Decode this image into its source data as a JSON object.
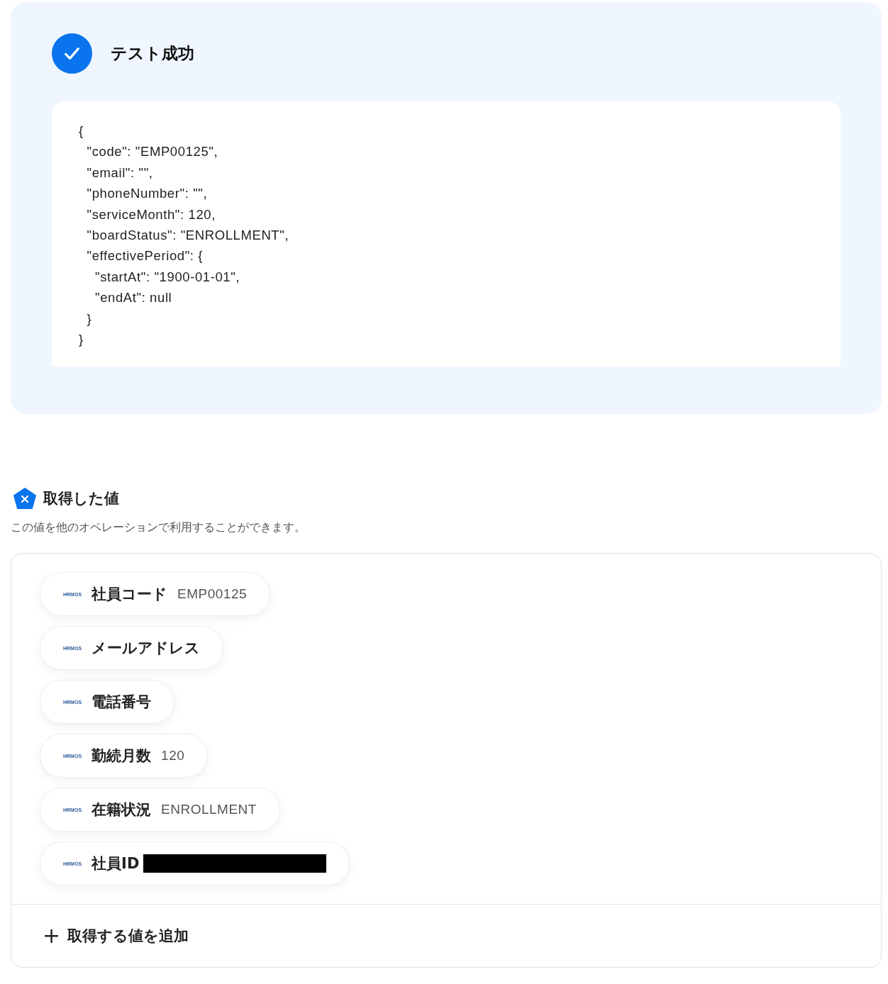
{
  "test_result": {
    "title": "テスト成功",
    "success": true,
    "code_lines": [
      "{",
      "  \"code\": \"EMP00125\",",
      "  \"email\": \"\",",
      "  \"phoneNumber\": \"\",",
      "  \"serviceMonth\": 120,",
      "  \"boardStatus\": \"ENROLLMENT\",",
      "  \"effectivePeriod\": {",
      "    \"startAt\": \"1900-01-01\",",
      "    \"endAt\": null",
      "  }",
      "}"
    ]
  },
  "values_section": {
    "title": "取得した値",
    "description": "この値を他のオペレーションで利用することができます。",
    "items": [
      {
        "logo": "HRMOS",
        "label": "社員コード",
        "value": "EMP00125",
        "redacted": false
      },
      {
        "logo": "HRMOS",
        "label": "メールアドレス",
        "redacted": false
      },
      {
        "logo": "HRMOS",
        "label": "電話番号",
        "redacted": false
      },
      {
        "logo": "HRMOS",
        "label": "勤続月数",
        "value": "120",
        "redacted": false
      },
      {
        "logo": "HRMOS",
        "label": "在籍状況",
        "value": "ENROLLMENT",
        "redacted": false
      },
      {
        "logo": "HRMOS",
        "label": "社員ID",
        "redacted": true
      }
    ],
    "add_button": {
      "icon": "+",
      "label": "取得する値を追加"
    }
  }
}
